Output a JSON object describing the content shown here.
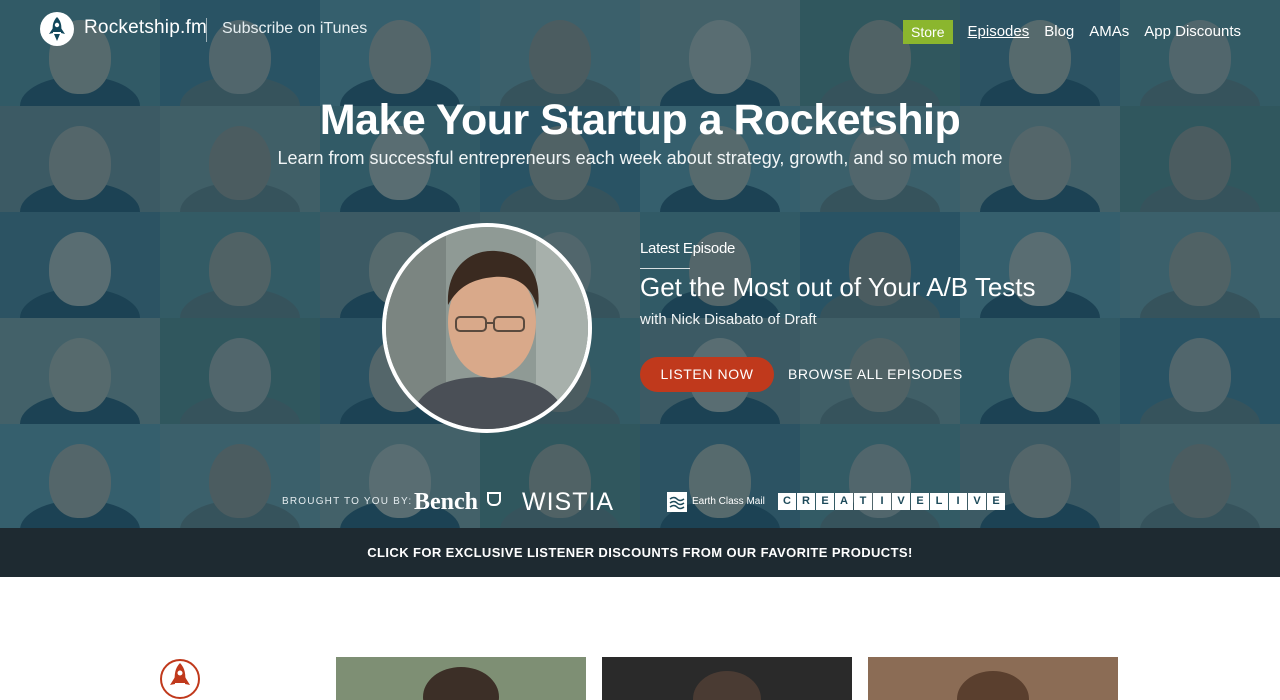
{
  "nav": {
    "brand": "Rocketship.fm",
    "itunes_link": "Subscribe on iTunes",
    "links": [
      {
        "label": "Store",
        "style": "store"
      },
      {
        "label": "Episodes",
        "style": "active"
      },
      {
        "label": "Blog",
        "style": "plain"
      },
      {
        "label": "AMAs",
        "style": "plain"
      },
      {
        "label": "App Discounts",
        "style": "plain"
      }
    ]
  },
  "hero": {
    "headline": "Make Your Startup a Rocketship",
    "tagline": "Learn from successful entrepreneurs each week about strategy, growth, and so much more"
  },
  "episode": {
    "label": "Latest Episode",
    "title": "Get the Most out of Your A/B Tests",
    "guest": "with Nick Disabato of Draft",
    "listen_button": "LISTEN NOW",
    "browse_link": "BROWSE ALL EPISODES"
  },
  "sponsors": {
    "label": "BROUGHT TO YOU BY:",
    "bench": "Bench",
    "wistia": "WISTIA",
    "earth_class_mail": "Earth Class Mail",
    "creativelive": [
      "C",
      "R",
      "E",
      "A",
      "T",
      "I",
      "V",
      "E",
      "L",
      "I",
      "V",
      "E"
    ]
  },
  "discount_bar": "CLICK FOR EXCLUSIVE LISTENER DISCOUNTS FROM OUR FAVORITE PRODUCTS!",
  "colors": {
    "overlay": "#12485c",
    "store_green": "#8bb62e",
    "listen_red": "#c0391c",
    "discount_bar": "#1e2a31"
  },
  "icons": [
    "rocket-icon"
  ]
}
